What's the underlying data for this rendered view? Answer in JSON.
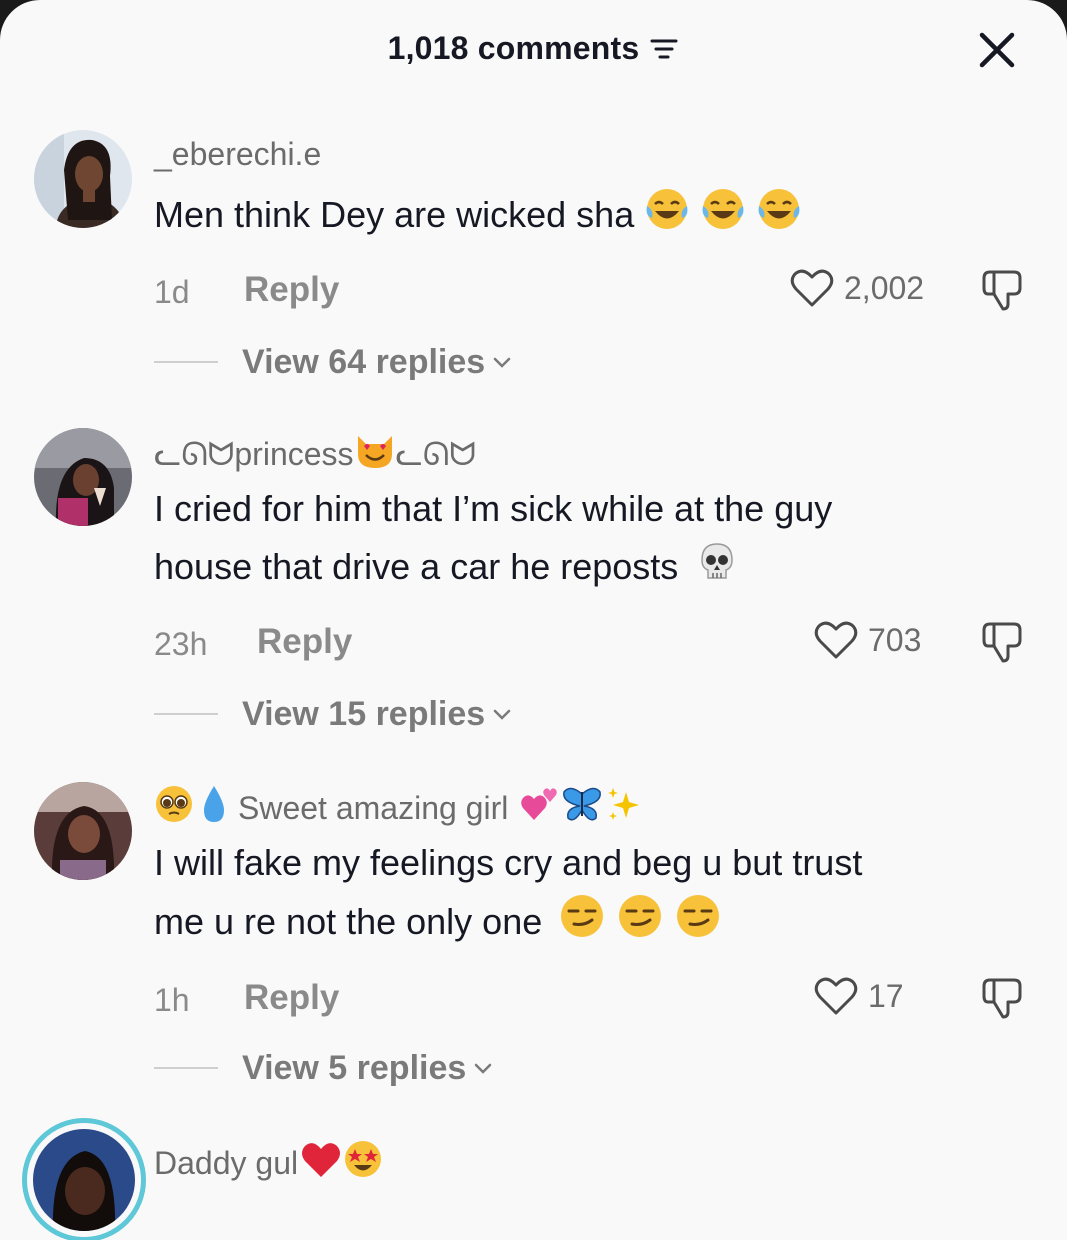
{
  "header": {
    "title": "1,018 comments"
  },
  "comments": [
    {
      "username": "_eberechi.e",
      "text": "Men think Dey are wicked sha",
      "emojis": [
        "face-with-tears-of-joy",
        "face-with-tears-of-joy",
        "face-with-tears-of-joy"
      ],
      "time": "1d",
      "reply_label": "Reply",
      "likes": "2,002",
      "view_replies": "View 64 replies"
    },
    {
      "username_prefix": "ᓚᘏᗢ",
      "username": "princess",
      "username_emojis": [
        "smiling-cat-heart-eyes"
      ],
      "username_suffix": "ᓚᘏᗢ",
      "text_line1": "I cried for him that I’m sick while at the guy",
      "text_line2": "house that drive a car he reposts",
      "emojis": [
        "skull"
      ],
      "time": "23h",
      "reply_label": "Reply",
      "likes": "703",
      "view_replies": "View 15 replies"
    },
    {
      "username_emojis_pre": [
        "pleading-face",
        "droplet"
      ],
      "username": "Sweet amazing girl",
      "username_emojis_post": [
        "two-hearts",
        "butterfly",
        "sparkles"
      ],
      "text_line1": "I will fake my feelings cry and beg u but trust",
      "text_line2": "me u re not the only one",
      "emojis": [
        "smirking-face",
        "smirking-face",
        "smirking-face"
      ],
      "time": "1h",
      "reply_label": "Reply",
      "likes": "17",
      "view_replies": "View 5 replies"
    },
    {
      "username": "Daddy gul",
      "username_emojis": [
        "red-heart",
        "star-struck"
      ]
    }
  ],
  "colors": {
    "background": "#f9f9f9",
    "text_primary": "#161823",
    "text_secondary": "#8a8a8a"
  }
}
